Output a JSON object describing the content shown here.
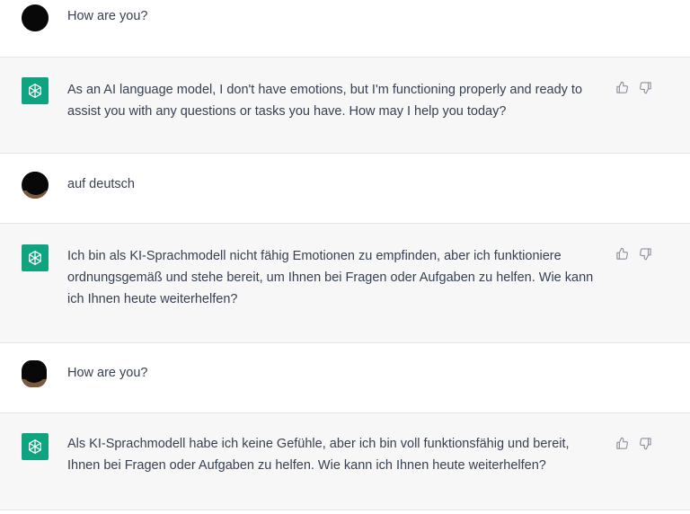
{
  "messages": [
    {
      "role": "user",
      "text": "How are you?"
    },
    {
      "role": "assistant",
      "text": "As an AI language model, I don't have emotions, but I'm functioning properly and ready to assist you with any questions or tasks you have. How may I help you today?"
    },
    {
      "role": "user",
      "text": "auf deutsch"
    },
    {
      "role": "assistant",
      "text": "Ich bin als KI-Sprachmodell nicht fähig Emotionen zu empfinden, aber ich funktioniere ordnungsgemäß und stehe bereit, um Ihnen bei Fragen oder Aufgaben zu helfen. Wie kann ich Ihnen heute weiterhelfen?"
    },
    {
      "role": "user",
      "text": "How are you?"
    },
    {
      "role": "assistant",
      "text": "Als KI-Sprachmodell habe ich keine Gefühle, aber ich bin voll funktionsfähig und bereit, Ihnen bei Fragen oder Aufgaben zu helfen. Wie kann ich Ihnen heute weiterhelfen?"
    }
  ],
  "icons": {
    "assistant_avatar": "openai-logo-icon",
    "thumbs_up": "thumbs-up-icon",
    "thumbs_down": "thumbs-down-icon"
  },
  "colors": {
    "assistant_avatar_bg": "#10a37f",
    "assistant_row_bg": "#f7f7f8",
    "user_row_bg": "#ffffff",
    "text": "#374151",
    "icon": "#8e8ea0"
  }
}
